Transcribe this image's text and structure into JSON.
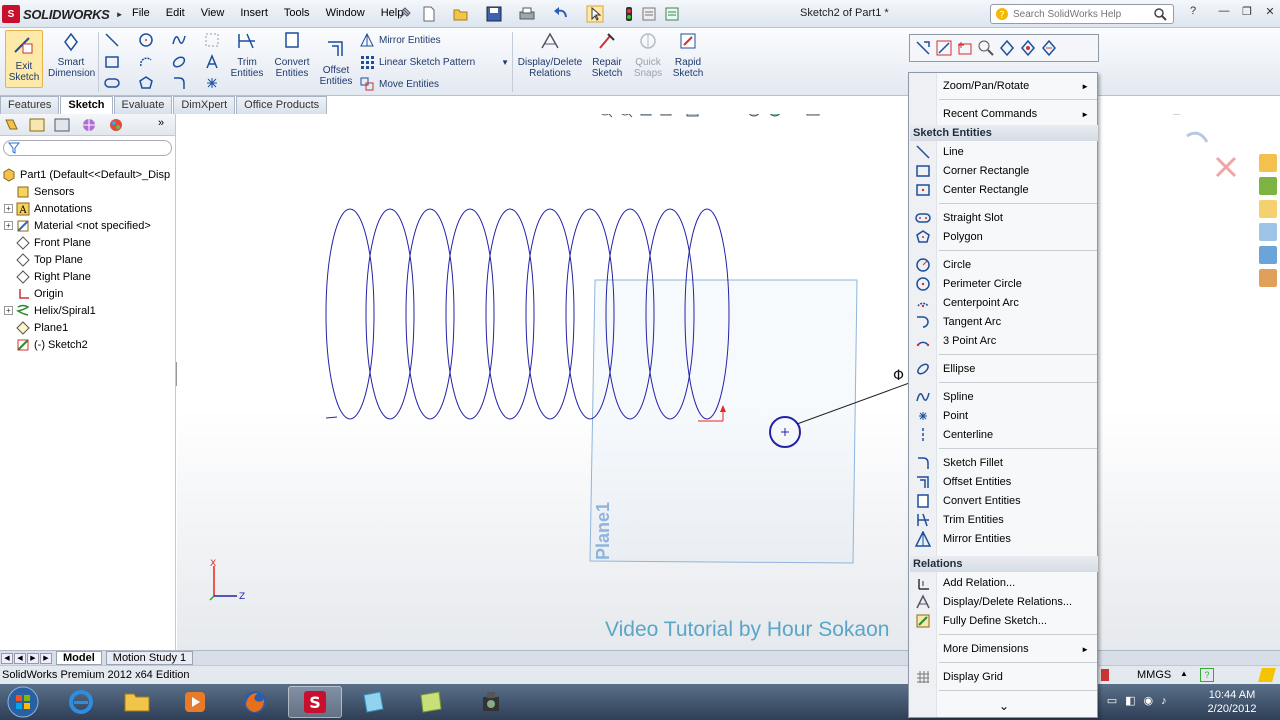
{
  "app": {
    "brand": "SOLIDWORKS",
    "document_title": "Sketch2 of Part1 *",
    "menu": [
      "File",
      "Edit",
      "View",
      "Insert",
      "Tools",
      "Window",
      "Help"
    ],
    "help_search_placeholder": "Search SolidWorks Help"
  },
  "commands": {
    "exit_sketch": [
      "Exit",
      "Sketch"
    ],
    "smart_dimension": [
      "Smart",
      "Dimension"
    ],
    "trim_entities": [
      "Trim",
      "Entities"
    ],
    "convert_entities": [
      "Convert",
      "Entities"
    ],
    "offset_entities": [
      "Offset",
      "Entities"
    ],
    "mirror_entities": "Mirror Entities",
    "linear_sketch_pattern": "Linear Sketch Pattern",
    "move_entities": "Move Entities",
    "display_delete_relations": [
      "Display/Delete",
      "Relations"
    ],
    "repair_sketch": [
      "Repair",
      "Sketch"
    ],
    "quick_snaps": [
      "Quick",
      "Snaps"
    ],
    "rapid_sketch": [
      "Rapid",
      "Sketch"
    ]
  },
  "tabs": [
    "Features",
    "Sketch",
    "Evaluate",
    "DimXpert",
    "Office Products"
  ],
  "active_tab": "Sketch",
  "feature_tree": [
    {
      "label": "Part1  (Default<<Default>_Disp",
      "icon": "part-icon",
      "expandable": false
    },
    {
      "label": "Sensors",
      "icon": "sensors-icon",
      "expandable": false
    },
    {
      "label": "Annotations",
      "icon": "annotations-icon",
      "expandable": true
    },
    {
      "label": "Material <not specified>",
      "icon": "material-icon",
      "expandable": true
    },
    {
      "label": "Front Plane",
      "icon": "plane-icon",
      "expandable": false
    },
    {
      "label": "Top Plane",
      "icon": "plane-icon",
      "expandable": false
    },
    {
      "label": "Right Plane",
      "icon": "plane-icon",
      "expandable": false
    },
    {
      "label": "Origin",
      "icon": "origin-icon",
      "expandable": false
    },
    {
      "label": "Helix/Spiral1",
      "icon": "helix-icon",
      "expandable": true
    },
    {
      "label": "Plane1",
      "icon": "plane-icon",
      "expandable": false
    },
    {
      "label": "(-) Sketch2",
      "icon": "sketch-icon",
      "expandable": false
    }
  ],
  "viewport": {
    "plane_label": "Plane1",
    "watermark": "Video Tutorial by Hour Sokaon",
    "triad_x": "X",
    "triad_z": "Z",
    "dimension_symbol": "Φ"
  },
  "context_menu": {
    "zoom_pan_rotate": "Zoom/Pan/Rotate",
    "recent_commands": "Recent Commands",
    "section_sketch_entities": "Sketch Entities",
    "line": "Line",
    "corner_rectangle": "Corner Rectangle",
    "center_rectangle": "Center Rectangle",
    "straight_slot": "Straight Slot",
    "polygon": "Polygon",
    "circle": "Circle",
    "perimeter_circle": "Perimeter Circle",
    "centerpoint_arc": "Centerpoint Arc",
    "tangent_arc": "Tangent Arc",
    "three_point_arc": "3 Point Arc",
    "ellipse": "Ellipse",
    "spline": "Spline",
    "point": "Point",
    "centerline": "Centerline",
    "sketch_fillet": "Sketch Fillet",
    "offset_entities": "Offset Entities",
    "convert_entities": "Convert Entities",
    "trim_entities": "Trim Entities",
    "mirror_entities": "Mirror Entities",
    "section_relations": "Relations",
    "add_relation": "Add Relation...",
    "display_delete_relations": "Display/Delete Relations...",
    "fully_define_sketch": "Fully Define Sketch...",
    "more_dimensions": "More Dimensions",
    "display_grid": "Display Grid",
    "more_indicator": "⌄"
  },
  "bottom_tabs": [
    "Model",
    "Motion Study 1"
  ],
  "active_bottom_tab": "Model",
  "status": {
    "edition": "SolidWorks Premium 2012 x64 Edition",
    "units": "MMGS"
  },
  "clock": {
    "time": "10:44 AM",
    "date": "2/20/2012"
  },
  "colors": {
    "sketch_blue": "#2323a8",
    "plane_blue": "#8fb4dc",
    "accent_red": "#c8102e",
    "watermark": "#5aa6c8"
  }
}
